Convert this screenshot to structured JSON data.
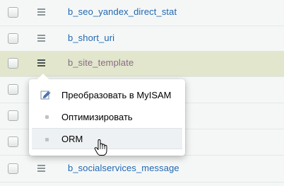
{
  "rows": [
    {
      "name": "b_seo_yandex_direct_stat"
    },
    {
      "name": "b_short_uri"
    },
    {
      "name": "b_site_template"
    },
    {
      "name": ""
    },
    {
      "name": ""
    },
    {
      "name": ""
    },
    {
      "name": "b_socialservices_message"
    }
  ],
  "menu": {
    "items": [
      {
        "label": "Преобразовать в MyISAM",
        "icon": "edit-icon"
      },
      {
        "label": "Оптимизировать",
        "icon": "bullet-icon"
      },
      {
        "label": "ORM",
        "icon": "bullet-icon"
      }
    ]
  },
  "colors": {
    "link": "#2067b0",
    "highlight_row": "#e1e6cc",
    "background": "#f5f7f7"
  }
}
